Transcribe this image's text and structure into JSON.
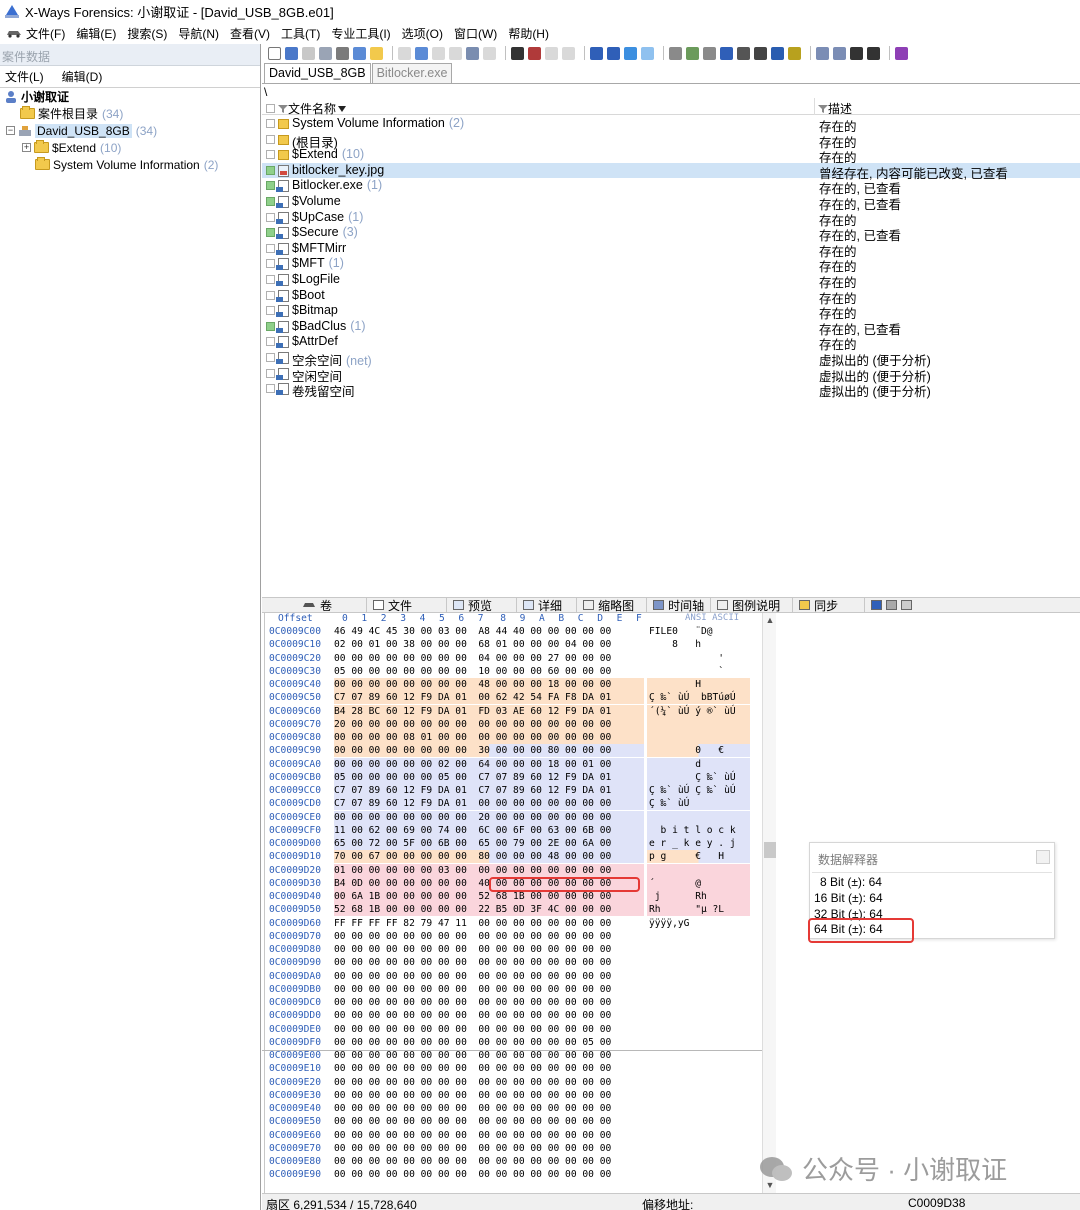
{
  "window": {
    "title": "X-Ways Forensics: 小谢取证 - [David_USB_8GB.e01]"
  },
  "menu": [
    "文件(F)",
    "编辑(E)",
    "搜索(S)",
    "导航(N)",
    "查看(V)",
    "工具(T)",
    "专业工具(I)",
    "选项(O)",
    "窗口(W)",
    "帮助(H)"
  ],
  "case_panel": {
    "header": "案件数据",
    "menu": [
      "文件(L)",
      "编辑(D)"
    ],
    "tree": [
      {
        "label": "小谢取证",
        "count": ""
      },
      {
        "label": "案件根目录",
        "count": "(34)"
      },
      {
        "label": "David_USB_8GB",
        "count": "(34)"
      },
      {
        "label": "$Extend",
        "count": "(10)"
      },
      {
        "label": "System Volume Information",
        "count": "(2)"
      }
    ]
  },
  "tabs": [
    "David_USB_8GB",
    "Bitlocker.exe"
  ],
  "path": "\\",
  "file_list": {
    "col_name": "文件名称",
    "col_desc": "描述",
    "rows": [
      {
        "name": "System Volume Information",
        "count": "(2)",
        "desc": "存在的",
        "icon": "folder",
        "green": false,
        "selected": false
      },
      {
        "name": "(根目录)",
        "count": "",
        "desc": "存在的",
        "icon": "folder",
        "green": false,
        "selected": false
      },
      {
        "name": "$Extend",
        "count": "(10)",
        "desc": "存在的",
        "icon": "folder",
        "green": false,
        "selected": false
      },
      {
        "name": "bitlocker_key.jpg",
        "count": "",
        "desc": "曾经存在, 内容可能已改变, 已查看",
        "icon": "image",
        "green": true,
        "selected": true
      },
      {
        "name": "Bitlocker.exe",
        "count": "(1)",
        "desc": "存在的, 已查看",
        "icon": "file",
        "green": true,
        "selected": false
      },
      {
        "name": "$Volume",
        "count": "",
        "desc": "存在的, 已查看",
        "icon": "file",
        "green": true,
        "selected": false
      },
      {
        "name": "$UpCase",
        "count": "(1)",
        "desc": "存在的",
        "icon": "file",
        "green": false,
        "selected": false
      },
      {
        "name": "$Secure",
        "count": "(3)",
        "desc": "存在的, 已查看",
        "icon": "file",
        "green": true,
        "selected": false
      },
      {
        "name": "$MFTMirr",
        "count": "",
        "desc": "存在的",
        "icon": "file",
        "green": false,
        "selected": false
      },
      {
        "name": "$MFT",
        "count": "(1)",
        "desc": "存在的",
        "icon": "file",
        "green": false,
        "selected": false
      },
      {
        "name": "$LogFile",
        "count": "",
        "desc": "存在的",
        "icon": "file",
        "green": false,
        "selected": false
      },
      {
        "name": "$Boot",
        "count": "",
        "desc": "存在的",
        "icon": "file",
        "green": false,
        "selected": false
      },
      {
        "name": "$Bitmap",
        "count": "",
        "desc": "存在的",
        "icon": "file",
        "green": false,
        "selected": false
      },
      {
        "name": "$BadClus",
        "count": "(1)",
        "desc": "存在的, 已查看",
        "icon": "file",
        "green": true,
        "selected": false
      },
      {
        "name": "$AttrDef",
        "count": "",
        "desc": "存在的",
        "icon": "file",
        "green": false,
        "selected": false
      },
      {
        "name": "空余空间",
        "count": "(net)",
        "desc": "虚拟出的 (便于分析)",
        "icon": "file",
        "green": false,
        "selected": false
      },
      {
        "name": "空闲空间",
        "count": "",
        "desc": "虚拟出的 (便于分析)",
        "icon": "file",
        "green": false,
        "selected": false
      },
      {
        "name": "卷残留空间",
        "count": "",
        "desc": "虚拟出的 (便于分析)",
        "icon": "file",
        "green": false,
        "selected": false
      }
    ]
  },
  "bottom_tabs": [
    "卷",
    "文件",
    "预览",
    "详细",
    "缩略图",
    "时间轴",
    "图例说明",
    "同步"
  ],
  "hex": {
    "offset_label": "Offset",
    "columns": [
      "0",
      "1",
      "2",
      "3",
      "4",
      "5",
      "6",
      "7",
      "8",
      "9",
      "A",
      "B",
      "C",
      "D",
      "E",
      "F"
    ],
    "ansi_label": "ANSI ASCII",
    "rows": [
      {
        "addr": "0C0009C00",
        "bytes": "46 49 4C 45 30 00 03 00  A8 44 40 00 00 00 00 00",
        "ascii": "FILE0   ¨D@",
        "style": "none"
      },
      {
        "addr": "0C0009C10",
        "bytes": "02 00 01 00 38 00 00 00  68 01 00 00 00 04 00 00",
        "ascii": "    8   h",
        "style": "none"
      },
      {
        "addr": "0C0009C20",
        "bytes": "00 00 00 00 00 00 00 00  04 00 00 00 27 00 00 00",
        "ascii": "            '",
        "style": "none"
      },
      {
        "addr": "0C0009C30",
        "bytes": "05 00 00 00 00 00 00 00  10 00 00 00 60 00 00 00",
        "ascii": "            `",
        "style": "none"
      },
      {
        "addr": "0C0009C40",
        "bytes": "00 00 00 00 00 00 00 00  48 00 00 00 18 00 00 00",
        "ascii": "        H",
        "style": "orange"
      },
      {
        "addr": "0C0009C50",
        "bytes": "C7 07 89 60 12 F9 DA 01  00 62 42 54 FA F8 DA 01",
        "ascii": "Ç ‰` ùÚ  bBTúøÚ",
        "style": "orange"
      },
      {
        "addr": "0C0009C60",
        "bytes": "B4 28 BC 60 12 F9 DA 01  FD 03 AE 60 12 F9 DA 01",
        "ascii": "´(¼` ùÚ ý ®` ùÚ",
        "style": "orange"
      },
      {
        "addr": "0C0009C70",
        "bytes": "20 00 00 00 00 00 00 00  00 00 00 00 00 00 00 00",
        "ascii": "",
        "style": "orange"
      },
      {
        "addr": "0C0009C80",
        "bytes": "00 00 00 00 08 01 00 00  00 00 00 00 00 00 00 00",
        "ascii": "",
        "style": "orange"
      },
      {
        "addr": "0C0009C90",
        "bytes": "00 00 00 00 00 00 00 00  30 00 00 00 80 00 00 00",
        "ascii": "        0   €",
        "style": "mix"
      },
      {
        "addr": "0C0009CA0",
        "bytes": "00 00 00 00 00 00 02 00  64 00 00 00 18 00 01 00",
        "ascii": "        d",
        "style": "blue"
      },
      {
        "addr": "0C0009CB0",
        "bytes": "05 00 00 00 00 00 05 00  C7 07 89 60 12 F9 DA 01",
        "ascii": "        Ç ‰` ùÚ",
        "style": "blue"
      },
      {
        "addr": "0C0009CC0",
        "bytes": "C7 07 89 60 12 F9 DA 01  C7 07 89 60 12 F9 DA 01",
        "ascii": "Ç ‰` ùÚ Ç ‰` ùÚ",
        "style": "blue"
      },
      {
        "addr": "0C0009CD0",
        "bytes": "C7 07 89 60 12 F9 DA 01  00 00 00 00 00 00 00 00",
        "ascii": "Ç ‰` ùÚ",
        "style": "blue"
      },
      {
        "addr": "0C0009CE0",
        "bytes": "00 00 00 00 00 00 00 00  20 00 00 00 00 00 00 00",
        "ascii": "",
        "style": "blue"
      },
      {
        "addr": "0C0009CF0",
        "bytes": "11 00 62 00 69 00 74 00  6C 00 6F 00 63 00 6B 00",
        "ascii": "  b i t l o c k",
        "style": "blue"
      },
      {
        "addr": "0C0009D00",
        "bytes": "65 00 72 00 5F 00 6B 00  65 00 79 00 2E 00 6A 00",
        "ascii": "e r _ k e y . j",
        "style": "blue"
      },
      {
        "addr": "0C0009D10",
        "bytes": "70 00 67 00 00 00 00 00  80 00 00 00 48 00 00 00",
        "ascii": "p g     €   H",
        "style": "mix"
      },
      {
        "addr": "0C0009D20",
        "bytes": "01 00 00 00 00 00 03 00  00 00 00 00 00 00 00 00",
        "ascii": "",
        "style": "pink"
      },
      {
        "addr": "0C0009D30",
        "bytes": "B4 0D 00 00 00 00 00 00  40 00 00 00 00 00 00 00",
        "ascii": "´       @",
        "style": "pink"
      },
      {
        "addr": "0C0009D40",
        "bytes": "00 6A 1B 00 00 00 00 00  52 68 1B 00 00 00 00 00",
        "ascii": " j      Rh",
        "style": "pink"
      },
      {
        "addr": "0C0009D50",
        "bytes": "52 68 1B 00 00 00 00 00  22 B5 0D 3F 4C 00 00 00",
        "ascii": "Rh      \"µ ?L",
        "style": "pink"
      },
      {
        "addr": "0C0009D60",
        "bytes": "FF FF FF FF 82 79 47 11  00 00 00 00 00 00 00 00",
        "ascii": "ÿÿÿÿ‚yG",
        "style": "none"
      },
      {
        "addr": "0C0009D70",
        "bytes": "00 00 00 00 00 00 00 00  00 00 00 00 00 00 00 00",
        "ascii": "",
        "style": "none"
      },
      {
        "addr": "0C0009D80",
        "bytes": "00 00 00 00 00 00 00 00  00 00 00 00 00 00 00 00",
        "ascii": "",
        "style": "none"
      },
      {
        "addr": "0C0009D90",
        "bytes": "00 00 00 00 00 00 00 00  00 00 00 00 00 00 00 00",
        "ascii": "",
        "style": "none"
      },
      {
        "addr": "0C0009DA0",
        "bytes": "00 00 00 00 00 00 00 00  00 00 00 00 00 00 00 00",
        "ascii": "",
        "style": "none"
      },
      {
        "addr": "0C0009DB0",
        "bytes": "00 00 00 00 00 00 00 00  00 00 00 00 00 00 00 00",
        "ascii": "",
        "style": "none"
      },
      {
        "addr": "0C0009DC0",
        "bytes": "00 00 00 00 00 00 00 00  00 00 00 00 00 00 00 00",
        "ascii": "",
        "style": "none"
      },
      {
        "addr": "0C0009DD0",
        "bytes": "00 00 00 00 00 00 00 00  00 00 00 00 00 00 00 00",
        "ascii": "",
        "style": "none"
      },
      {
        "addr": "0C0009DE0",
        "bytes": "00 00 00 00 00 00 00 00  00 00 00 00 00 00 00 00",
        "ascii": "",
        "style": "none"
      },
      {
        "addr": "0C0009DF0",
        "bytes": "00 00 00 00 00 00 00 00  00 00 00 00 00 00 05 00",
        "ascii": "",
        "style": "none"
      },
      {
        "addr": "0C0009E00",
        "bytes": "00 00 00 00 00 00 00 00  00 00 00 00 00 00 00 00",
        "ascii": "",
        "style": "none"
      },
      {
        "addr": "0C0009E10",
        "bytes": "00 00 00 00 00 00 00 00  00 00 00 00 00 00 00 00",
        "ascii": "",
        "style": "none"
      },
      {
        "addr": "0C0009E20",
        "bytes": "00 00 00 00 00 00 00 00  00 00 00 00 00 00 00 00",
        "ascii": "",
        "style": "none"
      },
      {
        "addr": "0C0009E30",
        "bytes": "00 00 00 00 00 00 00 00  00 00 00 00 00 00 00 00",
        "ascii": "",
        "style": "none"
      },
      {
        "addr": "0C0009E40",
        "bytes": "00 00 00 00 00 00 00 00  00 00 00 00 00 00 00 00",
        "ascii": "",
        "style": "none"
      },
      {
        "addr": "0C0009E50",
        "bytes": "00 00 00 00 00 00 00 00  00 00 00 00 00 00 00 00",
        "ascii": "",
        "style": "none"
      },
      {
        "addr": "0C0009E60",
        "bytes": "00 00 00 00 00 00 00 00  00 00 00 00 00 00 00 00",
        "ascii": "",
        "style": "none"
      },
      {
        "addr": "0C0009E70",
        "bytes": "00 00 00 00 00 00 00 00  00 00 00 00 00 00 00 00",
        "ascii": "",
        "style": "none"
      },
      {
        "addr": "0C0009E80",
        "bytes": "00 00 00 00 00 00 00 00  00 00 00 00 00 00 00 00",
        "ascii": "",
        "style": "none"
      },
      {
        "addr": "0C0009E90",
        "bytes": "00 00 00 00 00 00 00 00  00 00 00 00 00 00 00 00",
        "ascii": "",
        "style": "none"
      }
    ]
  },
  "interpreter": {
    "title": "数据解释器",
    "rows": [
      "8 Bit (±): 64",
      "16 Bit (±): 64",
      "32 Bit (±): 64",
      "64 Bit (±): 64"
    ]
  },
  "status": {
    "sector": "扇区 6,291,534 / 15,728,640",
    "offset_label": "偏移地址:",
    "offset_value": "C0009D38"
  },
  "watermark": "公众号 · 小谢取证",
  "colors": {
    "selection": "#cfe3f6",
    "hex_orange": "#fde1c8",
    "hex_blue": "#dfe3f8",
    "hex_pink": "#fad5dc",
    "highlight_red": "#e53935",
    "link_blue": "#2f5fb8"
  }
}
